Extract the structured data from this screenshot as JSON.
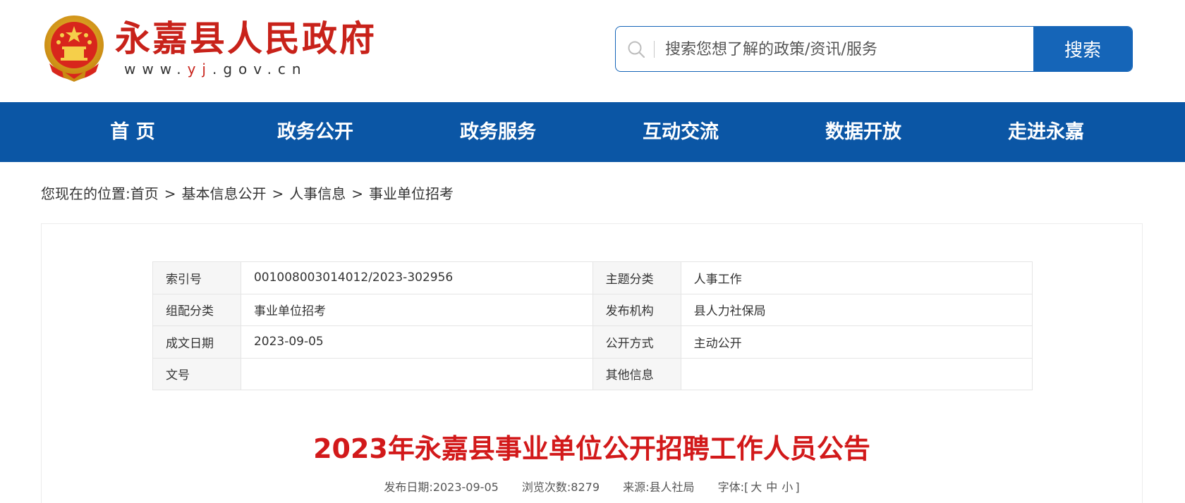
{
  "header": {
    "site_title": "永嘉县人民政府",
    "url_prefix": "www.",
    "url_highlight": "yj",
    "url_suffix": ".gov.cn",
    "search_placeholder": "搜索您想了解的政策/资讯/服务",
    "search_button": "搜索"
  },
  "nav": {
    "items": [
      "首 页",
      "政务公开",
      "政务服务",
      "互动交流",
      "数据开放",
      "走进永嘉"
    ]
  },
  "breadcrumb": {
    "prefix": "您现在的位置:",
    "items": [
      "首页",
      "基本信息公开",
      "人事信息",
      "事业单位招考"
    ],
    "separator": ">"
  },
  "info": {
    "rows": [
      {
        "l1": "索引号",
        "v1": "001008003014012/2023-302956",
        "l2": "主题分类",
        "v2": "人事工作"
      },
      {
        "l1": "组配分类",
        "v1": "事业单位招考",
        "l2": "发布机构",
        "v2": "县人力社保局"
      },
      {
        "l1": "成文日期",
        "v1": "2023-09-05",
        "l2": "公开方式",
        "v2": "主动公开"
      },
      {
        "l1": "文号",
        "v1": "",
        "l2": "其他信息",
        "v2": ""
      }
    ]
  },
  "article": {
    "title": "2023年永嘉县事业单位公开招聘工作人员公告",
    "publish_date": "发布日期:2023-09-05",
    "views": "浏览次数:8279",
    "source": "来源:县人社局",
    "font_label": "字体:[",
    "font_large": "大",
    "font_medium": "中",
    "font_small": "小",
    "font_close": "]"
  },
  "colors": {
    "brand_red": "#c8221a",
    "nav_blue": "#0b56a5",
    "title_red": "#d2191a"
  }
}
